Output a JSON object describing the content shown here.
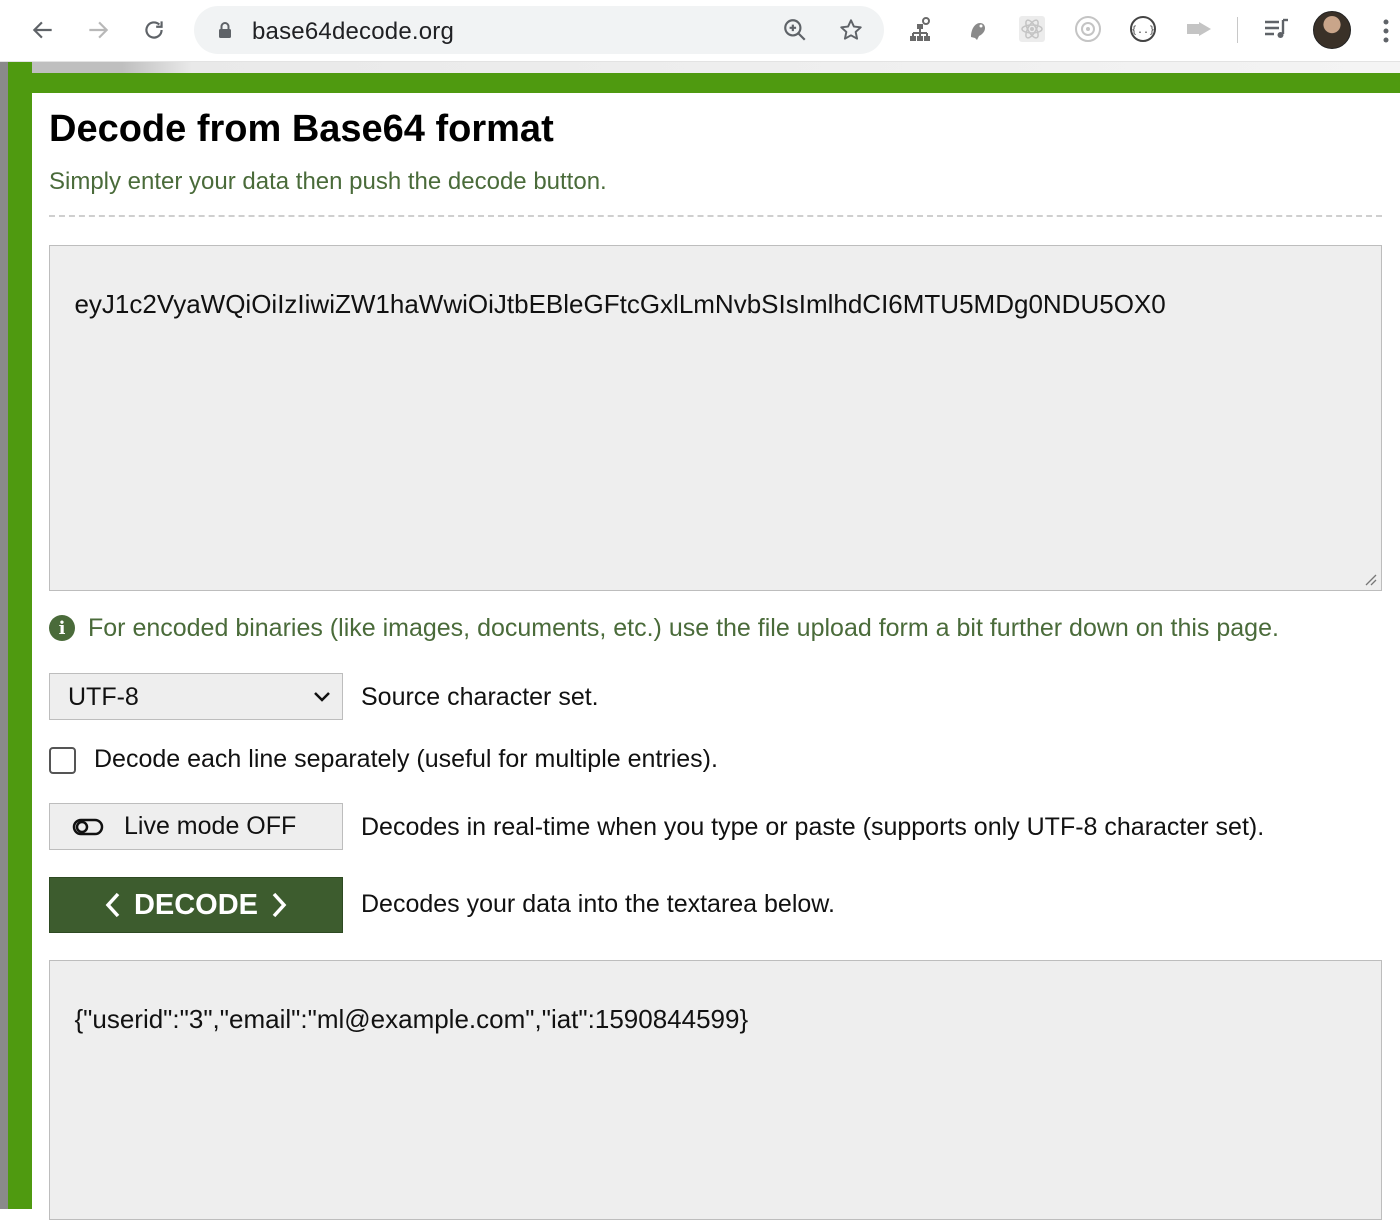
{
  "browser": {
    "url": "base64decode.org",
    "icons": {
      "back": "back-arrow-icon",
      "forward": "forward-arrow-icon",
      "reload": "reload-icon",
      "lock": "lock-icon",
      "zoom": "zoom-icon",
      "bookmark": "star-icon",
      "extensions": [
        "extension-network-icon",
        "extension-bird-icon",
        "extension-react-icon",
        "extension-target-icon",
        "extension-json-icon",
        "extension-cast-icon"
      ],
      "media": "media-playlist-icon",
      "profile": "avatar",
      "menu": "kebab-menu-icon"
    }
  },
  "colors": {
    "brand_green": "#4f9a10",
    "button_green": "#3d5c2e",
    "text_green": "#4a6b3a",
    "field_gray": "#eeeeee"
  },
  "page": {
    "title": "Decode from Base64 format",
    "subtitle": "Simply enter your data then push the decode button."
  },
  "input": {
    "value": "eyJ1c2VyaWQiOiIzIiwiZW1haWwiOiJtbEBleGFtcGxlLmNvbSIsImlhdCI6MTU5MDg0NDU5OX0"
  },
  "info": {
    "text": "For encoded binaries (like images, documents, etc.) use the file upload form a bit further down on this page."
  },
  "charset": {
    "selected": "UTF-8",
    "label": "Source character set."
  },
  "separate_lines": {
    "checked": false,
    "label": "Decode each line separately (useful for multiple entries)."
  },
  "live_mode": {
    "label": "Live mode OFF",
    "description": "Decodes in real-time when you type or paste (supports only UTF-8 character set)."
  },
  "decode": {
    "label": "DECODE",
    "description": "Decodes your data into the textarea below."
  },
  "output": {
    "value": "{\"userid\":\"3\",\"email\":\"ml@example.com\",\"iat\":1590844599}"
  }
}
